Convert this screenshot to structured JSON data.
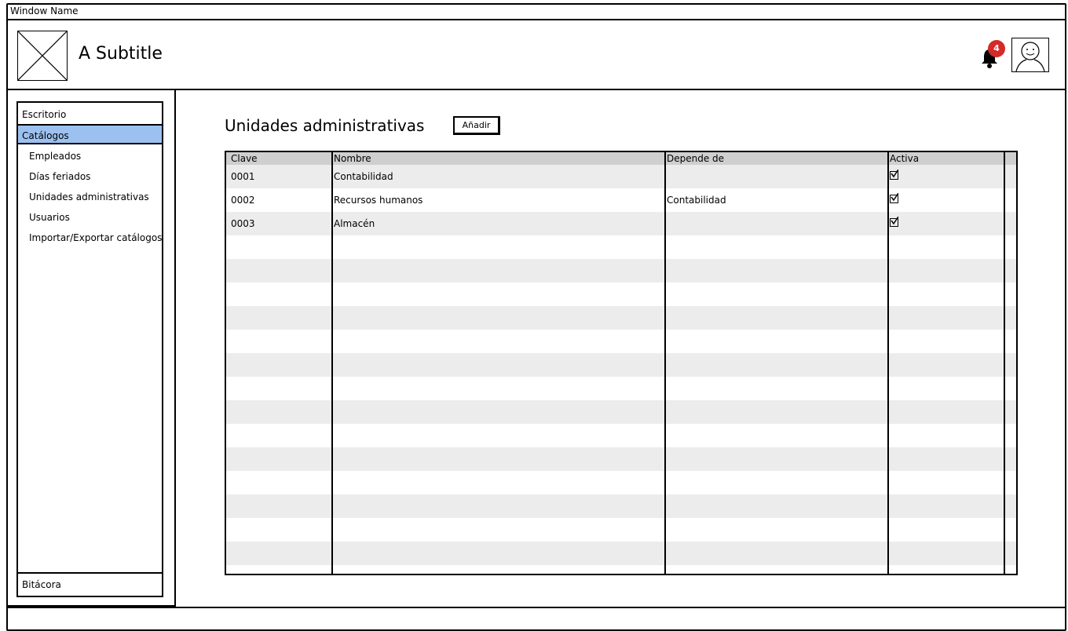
{
  "window": {
    "title": "Window Name"
  },
  "header": {
    "subtitle": "A Subtitle",
    "notifications_count": "4"
  },
  "sidebar": {
    "items": [
      {
        "label": "Escritorio"
      },
      {
        "label": "Catálogos",
        "selected": true
      }
    ],
    "sub_items": [
      {
        "label": "Empleados"
      },
      {
        "label": "Días feriados"
      },
      {
        "label": "Unidades administrativas"
      },
      {
        "label": "Usuarios"
      },
      {
        "label": "Importar/Exportar catálogos"
      }
    ],
    "footer_item": "Bitácora",
    "selected_color": "#9cc1f0"
  },
  "main": {
    "title": "Unidades administrativas",
    "add_button_label": "Añadir",
    "table": {
      "columns": [
        "Clave",
        "Nombre",
        "Depende de",
        "Activa"
      ],
      "rows": [
        {
          "clave": "0001",
          "nombre": "Contabilidad",
          "depende_de": "",
          "activa": true
        },
        {
          "clave": "0002",
          "nombre": "Recursos humanos",
          "depende_de": "Contabilidad",
          "activa": true
        },
        {
          "clave": "0003",
          "nombre": "Almacén",
          "depende_de": "",
          "activa": true
        }
      ]
    }
  },
  "colors": {
    "badge": "#d32a2a",
    "header_row": "#cfcfcf",
    "stripe": "#ececec"
  }
}
